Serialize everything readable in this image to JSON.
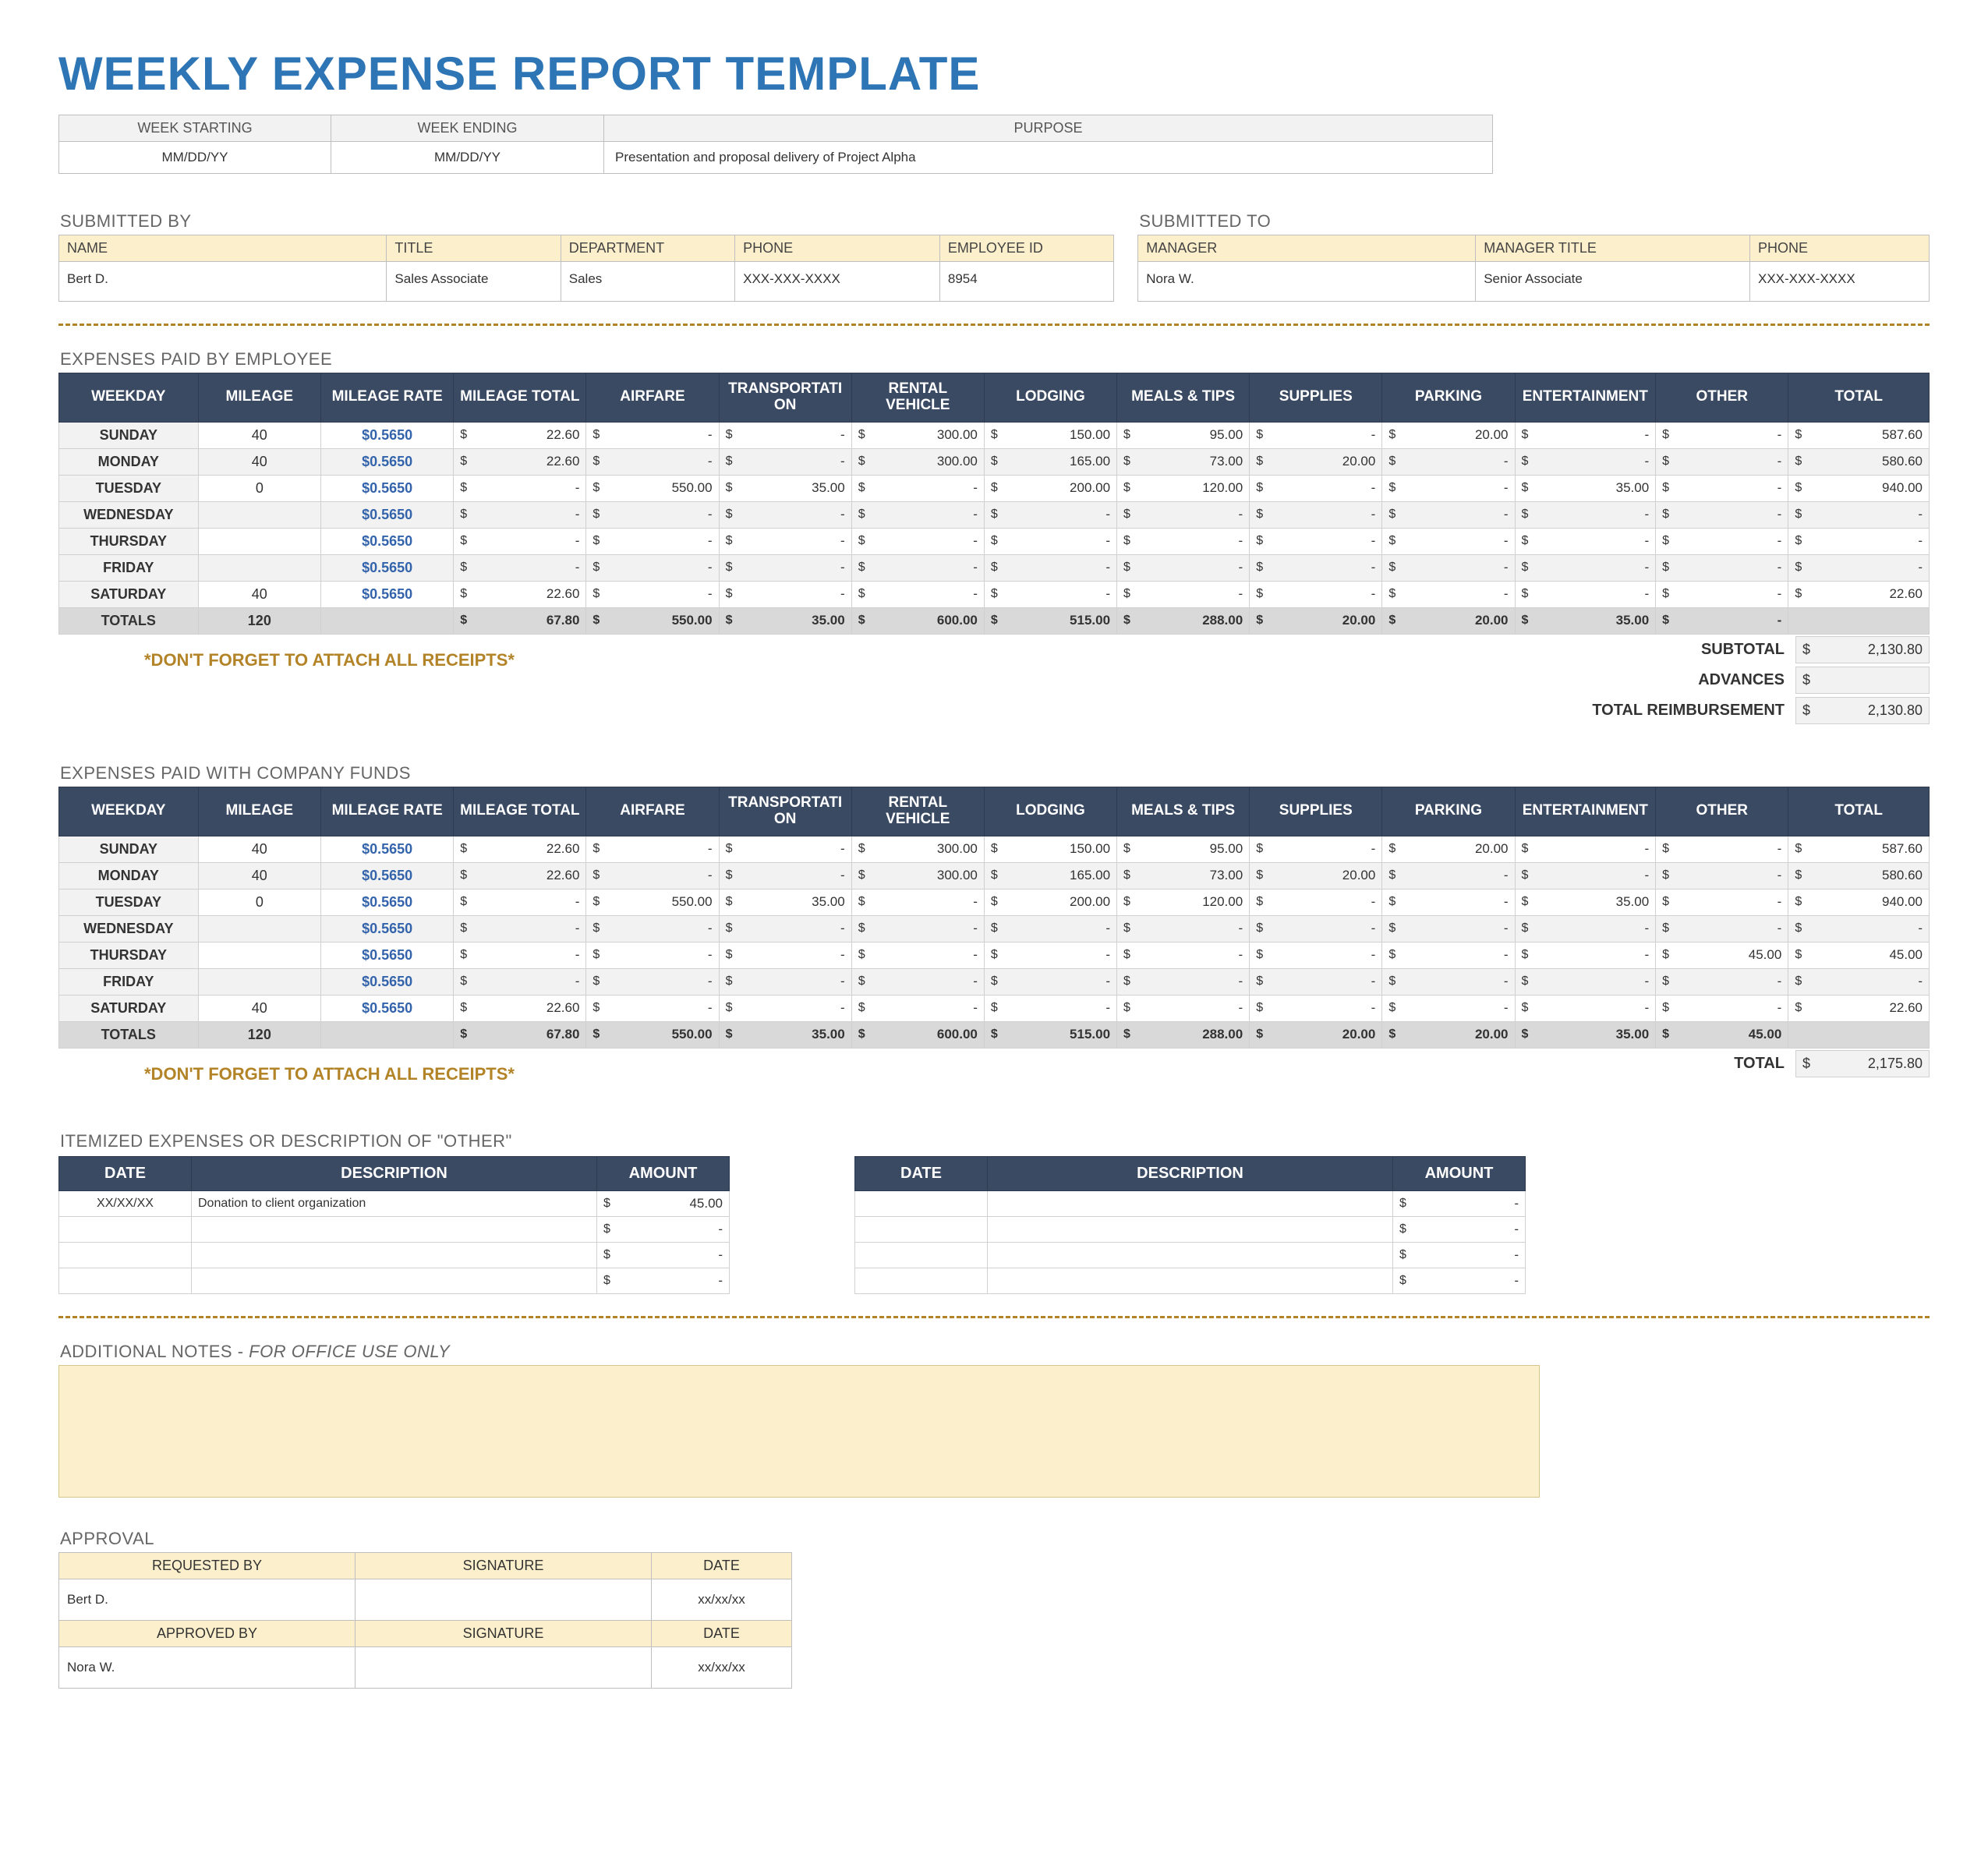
{
  "title": "WEEKLY EXPENSE REPORT TEMPLATE",
  "header": {
    "cols": [
      {
        "label": "WEEK STARTING",
        "value": "MM/DD/YY"
      },
      {
        "label": "WEEK ENDING",
        "value": "MM/DD/YY"
      },
      {
        "label": "PURPOSE",
        "value": "Presentation and proposal delivery of Project Alpha"
      }
    ]
  },
  "submitted_by": {
    "label": "SUBMITTED BY",
    "headers": [
      "NAME",
      "TITLE",
      "DEPARTMENT",
      "PHONE",
      "EMPLOYEE ID"
    ],
    "values": [
      "Bert D.",
      "Sales Associate",
      "Sales",
      "XXX-XXX-XXXX",
      "8954"
    ]
  },
  "submitted_to": {
    "label": "SUBMITTED TO",
    "headers": [
      "MANAGER",
      "MANAGER TITLE",
      "PHONE"
    ],
    "values": [
      "Nora W.",
      "Senior Associate",
      "XXX-XXX-XXXX"
    ]
  },
  "exp_headers": [
    "WEEKDAY",
    "MILEAGE",
    "MILEAGE RATE",
    "MILEAGE TOTAL",
    "AIRFARE",
    "TRANSPORTATION",
    "RENTAL VEHICLE",
    "LODGING",
    "MEALS & TIPS",
    "SUPPLIES",
    "PARKING",
    "ENTERTAINMENT",
    "OTHER",
    "TOTAL"
  ],
  "days": [
    "SUNDAY",
    "MONDAY",
    "TUESDAY",
    "WEDNESDAY",
    "THURSDAY",
    "FRIDAY",
    "SATURDAY"
  ],
  "mileage_rate": "$0.5650",
  "sections": {
    "employee": {
      "label": "EXPENSES PAID BY EMPLOYEE",
      "rows": [
        {
          "mileage": "40",
          "mileage_total": "22.60",
          "airfare": "-",
          "transport": "-",
          "rental": "300.00",
          "lodging": "150.00",
          "meals": "95.00",
          "supplies": "-",
          "parking": "20.00",
          "ent": "-",
          "other": "-",
          "total": "587.60"
        },
        {
          "mileage": "40",
          "mileage_total": "22.60",
          "airfare": "-",
          "transport": "-",
          "rental": "300.00",
          "lodging": "165.00",
          "meals": "73.00",
          "supplies": "20.00",
          "parking": "-",
          "ent": "-",
          "other": "-",
          "total": "580.60"
        },
        {
          "mileage": "0",
          "mileage_total": "-",
          "airfare": "550.00",
          "transport": "35.00",
          "rental": "-",
          "lodging": "200.00",
          "meals": "120.00",
          "supplies": "-",
          "parking": "-",
          "ent": "35.00",
          "other": "-",
          "total": "940.00"
        },
        {
          "mileage": "",
          "mileage_total": "-",
          "airfare": "-",
          "transport": "-",
          "rental": "-",
          "lodging": "-",
          "meals": "-",
          "supplies": "-",
          "parking": "-",
          "ent": "-",
          "other": "-",
          "total": "-"
        },
        {
          "mileage": "",
          "mileage_total": "-",
          "airfare": "-",
          "transport": "-",
          "rental": "-",
          "lodging": "-",
          "meals": "-",
          "supplies": "-",
          "parking": "-",
          "ent": "-",
          "other": "-",
          "total": "-"
        },
        {
          "mileage": "",
          "mileage_total": "-",
          "airfare": "-",
          "transport": "-",
          "rental": "-",
          "lodging": "-",
          "meals": "-",
          "supplies": "-",
          "parking": "-",
          "ent": "-",
          "other": "-",
          "total": "-"
        },
        {
          "mileage": "40",
          "mileage_total": "22.60",
          "airfare": "-",
          "transport": "-",
          "rental": "-",
          "lodging": "-",
          "meals": "-",
          "supplies": "-",
          "parking": "-",
          "ent": "-",
          "other": "-",
          "total": "22.60"
        }
      ],
      "totals": {
        "label": "TOTALS",
        "mileage": "120",
        "mileage_total": "67.80",
        "airfare": "550.00",
        "transport": "35.00",
        "rental": "600.00",
        "lodging": "515.00",
        "meals": "288.00",
        "supplies": "20.00",
        "parking": "20.00",
        "ent": "35.00",
        "other": "-",
        "total": ""
      },
      "summary": [
        {
          "lbl": "SUBTOTAL",
          "val": "2,130.80"
        },
        {
          "lbl": "ADVANCES",
          "val": ""
        },
        {
          "lbl": "TOTAL REIMBURSEMENT",
          "val": "2,130.80"
        }
      ]
    },
    "company": {
      "label": "EXPENSES PAID WITH COMPANY FUNDS",
      "rows": [
        {
          "mileage": "40",
          "mileage_total": "22.60",
          "airfare": "-",
          "transport": "-",
          "rental": "300.00",
          "lodging": "150.00",
          "meals": "95.00",
          "supplies": "-",
          "parking": "20.00",
          "ent": "-",
          "other": "-",
          "total": "587.60"
        },
        {
          "mileage": "40",
          "mileage_total": "22.60",
          "airfare": "-",
          "transport": "-",
          "rental": "300.00",
          "lodging": "165.00",
          "meals": "73.00",
          "supplies": "20.00",
          "parking": "-",
          "ent": "-",
          "other": "-",
          "total": "580.60"
        },
        {
          "mileage": "0",
          "mileage_total": "-",
          "airfare": "550.00",
          "transport": "35.00",
          "rental": "-",
          "lodging": "200.00",
          "meals": "120.00",
          "supplies": "-",
          "parking": "-",
          "ent": "35.00",
          "other": "-",
          "total": "940.00"
        },
        {
          "mileage": "",
          "mileage_total": "-",
          "airfare": "-",
          "transport": "-",
          "rental": "-",
          "lodging": "-",
          "meals": "-",
          "supplies": "-",
          "parking": "-",
          "ent": "-",
          "other": "-",
          "total": "-"
        },
        {
          "mileage": "",
          "mileage_total": "-",
          "airfare": "-",
          "transport": "-",
          "rental": "-",
          "lodging": "-",
          "meals": "-",
          "supplies": "-",
          "parking": "-",
          "ent": "-",
          "other": "45.00",
          "total": "45.00"
        },
        {
          "mileage": "",
          "mileage_total": "-",
          "airfare": "-",
          "transport": "-",
          "rental": "-",
          "lodging": "-",
          "meals": "-",
          "supplies": "-",
          "parking": "-",
          "ent": "-",
          "other": "-",
          "total": "-"
        },
        {
          "mileage": "40",
          "mileage_total": "22.60",
          "airfare": "-",
          "transport": "-",
          "rental": "-",
          "lodging": "-",
          "meals": "-",
          "supplies": "-",
          "parking": "-",
          "ent": "-",
          "other": "-",
          "total": "22.60"
        }
      ],
      "totals": {
        "label": "TOTALS",
        "mileage": "120",
        "mileage_total": "67.80",
        "airfare": "550.00",
        "transport": "35.00",
        "rental": "600.00",
        "lodging": "515.00",
        "meals": "288.00",
        "supplies": "20.00",
        "parking": "20.00",
        "ent": "35.00",
        "other": "45.00",
        "total": ""
      },
      "summary": [
        {
          "lbl": "TOTAL",
          "val": "2,175.80"
        }
      ]
    }
  },
  "receipt_note": "*DON'T FORGET TO ATTACH ALL RECEIPTS*",
  "itemized": {
    "label": "ITEMIZED EXPENSES OR DESCRIPTION OF \"OTHER\"",
    "headers": [
      "DATE",
      "DESCRIPTION",
      "AMOUNT"
    ],
    "left": [
      {
        "date": "XX/XX/XX",
        "desc": "Donation to client organization",
        "amount": "45.00"
      },
      {
        "date": "",
        "desc": "",
        "amount": "-"
      },
      {
        "date": "",
        "desc": "",
        "amount": "-"
      },
      {
        "date": "",
        "desc": "",
        "amount": "-"
      }
    ],
    "right": [
      {
        "date": "",
        "desc": "",
        "amount": "-"
      },
      {
        "date": "",
        "desc": "",
        "amount": "-"
      },
      {
        "date": "",
        "desc": "",
        "amount": "-"
      },
      {
        "date": "",
        "desc": "",
        "amount": "-"
      }
    ]
  },
  "notes_label": "ADDITIONAL NOTES -",
  "notes_sub": "FOR OFFICE USE ONLY",
  "approval": {
    "label": "APPROVAL",
    "headers": [
      "REQUESTED BY",
      "SIGNATURE",
      "DATE"
    ],
    "headers2": [
      "APPROVED BY",
      "SIGNATURE",
      "DATE"
    ],
    "req": {
      "name": "Bert D.",
      "sig": "",
      "date": "xx/xx/xx"
    },
    "appr": {
      "name": "Nora W.",
      "sig": "",
      "date": "xx/xx/xx"
    }
  }
}
